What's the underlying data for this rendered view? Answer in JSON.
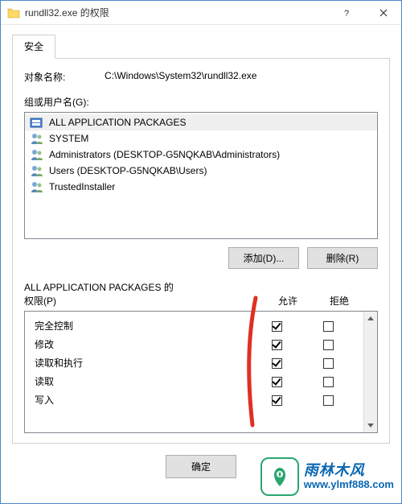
{
  "title": "rundll32.exe 的权限",
  "tab_security": "安全",
  "object_name_label": "对象名称:",
  "object_name_value": "C:\\Windows\\System32\\rundll32.exe",
  "groups_label": "组或用户名(G):",
  "groups": [
    {
      "name": "ALL APPLICATION PACKAGES",
      "icon": "pkg",
      "selected": true
    },
    {
      "name": "SYSTEM",
      "icon": "users"
    },
    {
      "name": "Administrators (DESKTOP-G5NQKAB\\Administrators)",
      "icon": "users"
    },
    {
      "name": "Users (DESKTOP-G5NQKAB\\Users)",
      "icon": "users"
    },
    {
      "name": "TrustedInstaller",
      "icon": "user"
    }
  ],
  "add_btn": "添加(D)...",
  "remove_btn": "删除(R)",
  "perm_label_line1": "ALL APPLICATION PACKAGES 的",
  "perm_label_line2": "权限(P)",
  "col_allow": "允许",
  "col_deny": "拒绝",
  "permissions": [
    {
      "name": "完全控制",
      "allow": true,
      "deny": false
    },
    {
      "name": "修改",
      "allow": true,
      "deny": false
    },
    {
      "name": "读取和执行",
      "allow": true,
      "deny": false
    },
    {
      "name": "读取",
      "allow": true,
      "deny": false
    },
    {
      "name": "写入",
      "allow": true,
      "deny": false
    }
  ],
  "ok_btn": "确定",
  "logo": {
    "cn": "雨林木风",
    "url": "www.ylmf888.com"
  }
}
